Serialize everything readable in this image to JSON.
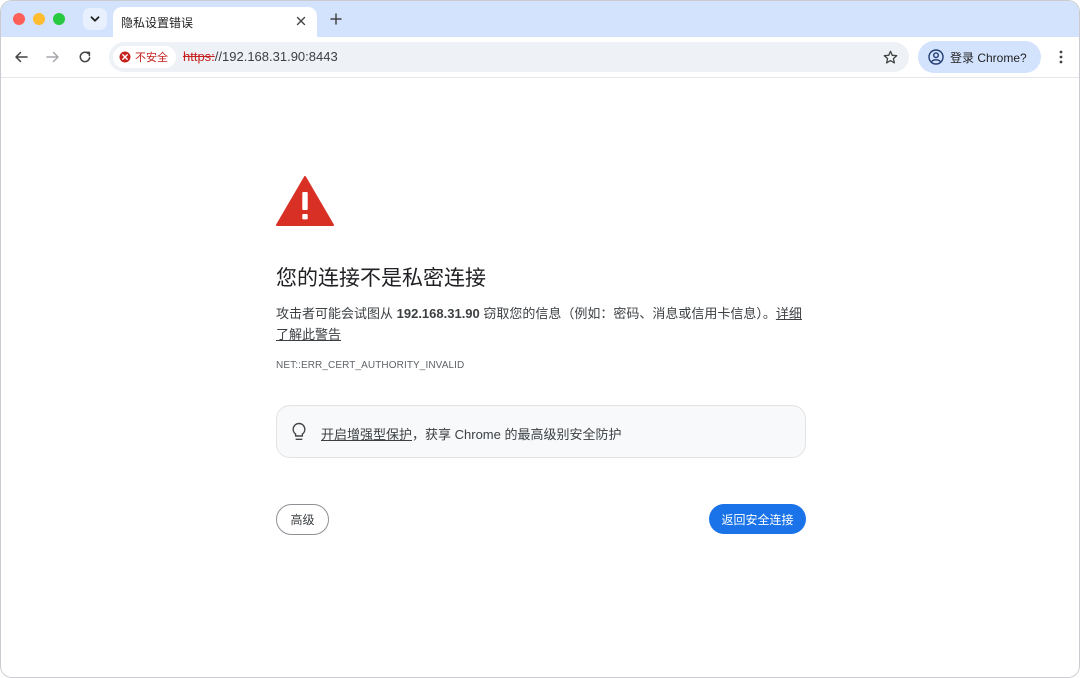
{
  "tab": {
    "title": "隐私设置错误"
  },
  "toolbar": {
    "security_chip": "不安全",
    "url_scheme": "https:",
    "url_rest": "//192.168.31.90:8443",
    "profile_label": "登录 Chrome?"
  },
  "page": {
    "heading": "您的连接不是私密连接",
    "desc_prefix": "攻击者可能会试图从 ",
    "desc_host": "192.168.31.90",
    "desc_suffix": " 窃取您的信息（例如：密码、消息或信用卡信息）。",
    "desc_link": "详细了解此警告",
    "error_code": "NET::ERR_CERT_AUTHORITY_INVALID",
    "tip_link": "开启增强型保护",
    "tip_rest": "，获享 Chrome 的最高级别安全防护",
    "advanced_button": "高级",
    "back_button": "返回安全连接"
  },
  "colors": {
    "tabstrip": "#d3e3fd",
    "warning_red": "#d93025",
    "primary_blue": "#1a73e8"
  },
  "icons": [
    "tab-search-icon",
    "close-icon",
    "plus-icon",
    "back-arrow-icon",
    "forward-arrow-icon",
    "reload-icon",
    "not-secure-icon",
    "star-icon",
    "profile-icon",
    "more-vert-icon",
    "warning-triangle-icon",
    "lightbulb-icon"
  ]
}
